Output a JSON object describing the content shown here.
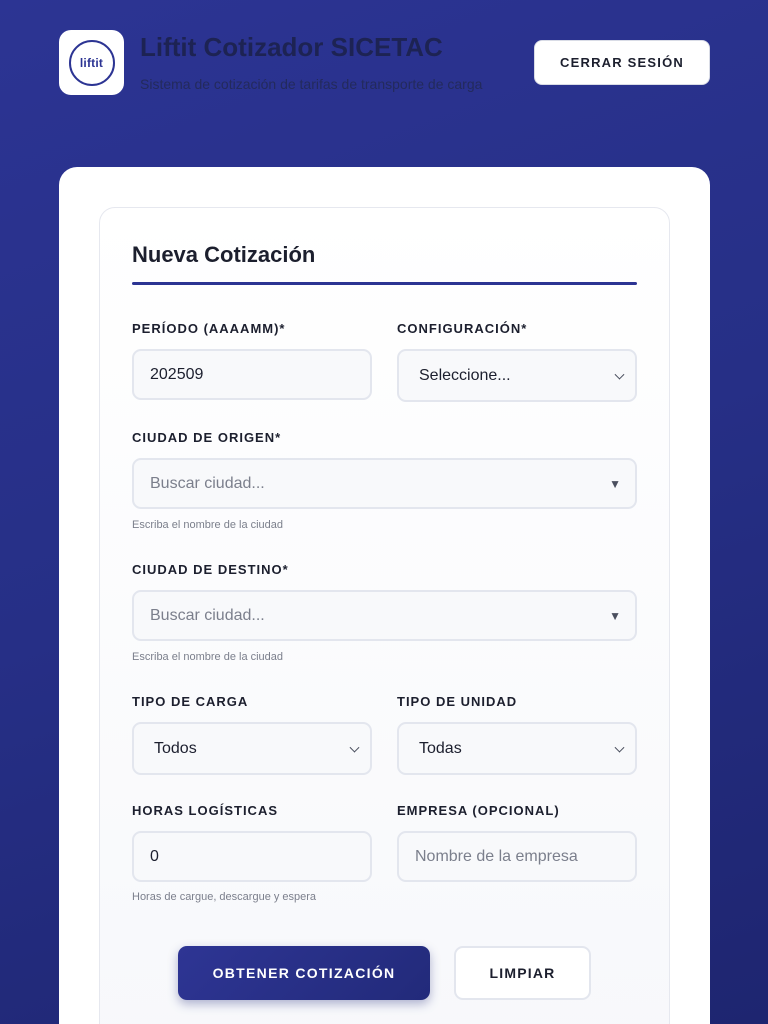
{
  "header": {
    "logo_text": "liftit",
    "title": "Liftit Cotizador SICETAC",
    "subtitle": "Sistema de cotización de tarifas de transporte de carga",
    "logout_label": "CERRAR SESIÓN"
  },
  "form": {
    "title": "Nueva Cotización",
    "periodo": {
      "label": "PERÍODO (AAAAMM)*",
      "value": "202509"
    },
    "configuracion": {
      "label": "CONFIGURACIÓN*",
      "selected": "Seleccione..."
    },
    "origen": {
      "label": "CIUDAD DE ORIGEN*",
      "placeholder": "Buscar ciudad...",
      "hint": "Escriba el nombre de la ciudad"
    },
    "destino": {
      "label": "CIUDAD DE DESTINO*",
      "placeholder": "Buscar ciudad...",
      "hint": "Escriba el nombre de la ciudad"
    },
    "tipo_carga": {
      "label": "TIPO DE CARGA",
      "selected": "Todos"
    },
    "tipo_unidad": {
      "label": "TIPO DE UNIDAD",
      "selected": "Todas"
    },
    "horas": {
      "label": "HORAS LOGÍSTICAS",
      "value": "0",
      "hint": "Horas de cargue, descargue y espera"
    },
    "empresa": {
      "label": "EMPRESA (OPCIONAL)",
      "placeholder": "Nombre de la empresa"
    },
    "submit_label": "OBTENER COTIZACIÓN",
    "clear_label": "LIMPIAR"
  },
  "colors": {
    "primary": "#2c3493",
    "background": "#262f86",
    "text": "#1c1f2e"
  },
  "icons": {
    "dropdown": "caret-down-icon",
    "select": "chevron-down-icon"
  }
}
